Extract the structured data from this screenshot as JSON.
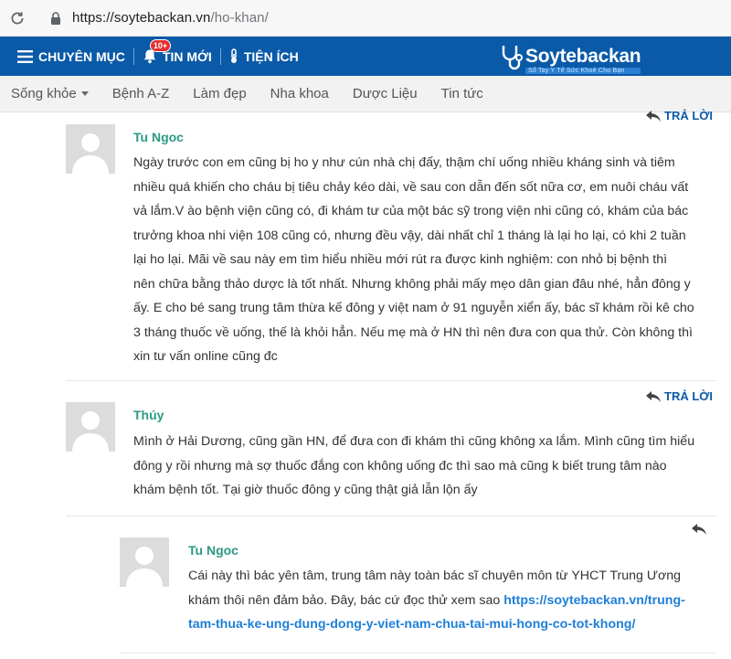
{
  "browser": {
    "url_host": "https://soytebackan.vn",
    "url_path": "/ho-khan/"
  },
  "topnav": {
    "categories_label": "CHUYÊN MỤC",
    "news_label": "TIN MỚI",
    "news_badge": "10+",
    "utilities_label": "TIỆN ÍCH",
    "logo_title": "Soytebackan",
    "logo_subtitle": "Sổ Tay Y Tế Sức Khoẻ Cho Bạn"
  },
  "subnav": {
    "items": [
      "Sống khỏe",
      "Bệnh A-Z",
      "Làm đẹp",
      "Nha khoa",
      "Dược Liệu",
      "Tin tức"
    ]
  },
  "comments": {
    "reply_label": "TRẢ LỜI",
    "c1": {
      "author": "Tu Ngoc",
      "lines": [
        "Ngày trước con em cũng bị ho y như cún nhà chị đấy, thậm chí uống nhiều kháng sinh và tiêm",
        "nhiều quá khiến cho cháu bị tiêu chảy kéo dài, về sau con dẫn đến sốt nữa cơ, em nuôi cháu vất",
        "vả lắm.V ào bệnh viện cũng có, đi khám tư của một bác sỹ trong viện nhi cũng có, khám của bác",
        "trưởng khoa nhi viện 108 cũng có, nhưng đều vậy, dài nhất chỉ 1 tháng là lại ho lại, có khi 2 tuần",
        "lại ho lại. Mãi về sau này em tìm hiểu nhiều mới rút ra được kinh nghiệm: con nhỏ bị bệnh thì",
        "nên chữa bằng thảo dược là tốt nhất. Nhưng không phải mấy mẹo dân gian đâu nhé, hẳn đông y",
        "ấy. E cho bé sang trung tâm thừa kế đông y việt nam ở 91 nguyễn xiển ấy, bác sĩ khám rồi kê cho",
        "3 tháng thuốc về uống, thế là khỏi hẳn. Nếu mẹ mà ở HN thì nên đưa con qua thử. Còn không thì",
        "xin tư vấn online cũng đc"
      ]
    },
    "c2": {
      "author": "Thúy",
      "lines": [
        "Mình ở Hải Dương, cũng gần HN, để đưa con đi khám thì cũng không xa lắm. Mình cũng tìm hiểu",
        "đông y rồi nhưng mà sợ thuốc đắng con không uống đc thì sao mà cũng k biết trung tâm nào",
        "khám bệnh tốt. Tại giờ thuốc đông y cũng thật giả lẫn lộn ấy"
      ]
    },
    "c3": {
      "author": "Tu Ngoc",
      "line1": "Cái này thì bác yên tâm, trung tâm này toàn bác sĩ chuyên môn từ YHCT Trung Ương",
      "line2_text": "khám thôi nên đảm bảo. Đây, bác cứ đọc thử xem sao ",
      "link_part1": "https://soytebackan.vn/trung-",
      "link_part2": "tam-thua-ke-ung-dung-dong-y-viet-nam-chua-tai-mui-hong-co-tot-khong/"
    }
  },
  "colors": {
    "nav_blue": "#0a5aa8",
    "author_green": "#2b9a85",
    "link_blue": "#1e7fd8",
    "badge_red": "#e62e2e"
  }
}
